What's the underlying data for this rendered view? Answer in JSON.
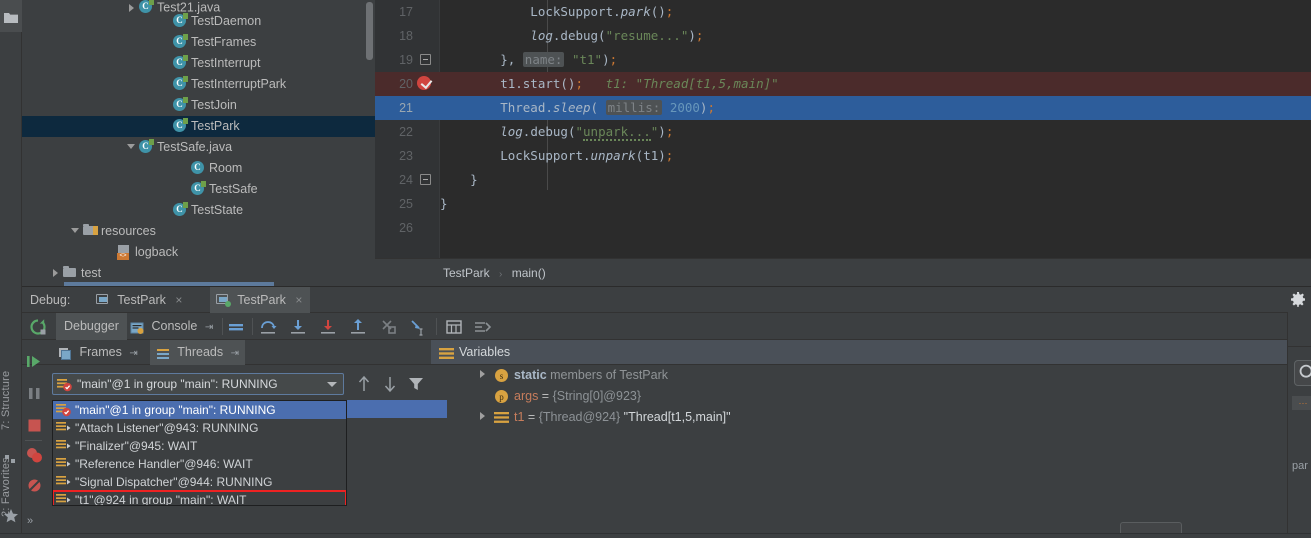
{
  "left_strip": {
    "folder_icon": "folder-icon",
    "tabs": [
      {
        "label": "7: Structure",
        "icon": "structure-icon"
      },
      {
        "label": "2: Favorites",
        "icon": "star-icon"
      }
    ]
  },
  "project_tree": {
    "items": [
      {
        "label": "Test21.java",
        "icon": "java-class-icon",
        "arrow": "collapsed",
        "indent": 118,
        "selected": false,
        "clipped": true
      },
      {
        "label": "TestDaemon",
        "icon": "java-class-icon",
        "arrow": "none",
        "indent": 152,
        "selected": false
      },
      {
        "label": "TestFrames",
        "icon": "java-class-icon",
        "arrow": "none",
        "indent": 152,
        "selected": false
      },
      {
        "label": "TestInterrupt",
        "icon": "java-class-icon",
        "arrow": "none",
        "indent": 152,
        "selected": false
      },
      {
        "label": "TestInterruptPark",
        "icon": "java-class-icon",
        "arrow": "none",
        "indent": 152,
        "selected": false
      },
      {
        "label": "TestJoin",
        "icon": "java-class-icon",
        "arrow": "none",
        "indent": 152,
        "selected": false
      },
      {
        "label": "TestPark",
        "icon": "java-class-icon",
        "arrow": "none",
        "indent": 152,
        "selected": true
      },
      {
        "label": "TestSafe.java",
        "icon": "java-class-icon",
        "arrow": "expanded",
        "indent": 118,
        "selected": false
      },
      {
        "label": "Room",
        "icon": "class-icon",
        "arrow": "none",
        "indent": 170,
        "selected": false
      },
      {
        "label": "TestSafe",
        "icon": "java-class-icon",
        "arrow": "none",
        "indent": 170,
        "selected": false
      },
      {
        "label": "TestState",
        "icon": "java-class-icon",
        "arrow": "none",
        "indent": 152,
        "selected": false
      },
      {
        "label": "resources",
        "icon": "resources-folder-icon",
        "arrow": "expanded",
        "indent": 62,
        "selected": false
      },
      {
        "label": "logback",
        "icon": "xml-file-icon",
        "arrow": "none",
        "indent": 96,
        "selected": false
      },
      {
        "label": "test",
        "icon": "folder-icon",
        "arrow": "collapsed",
        "indent": 42,
        "selected": false
      }
    ]
  },
  "editor": {
    "lines": [
      {
        "num": "17",
        "fold": false,
        "breakpoint": false,
        "current": false,
        "tokens": [
          {
            "t": "            LockSupport.",
            "c": "ident"
          },
          {
            "t": "park",
            "c": "meth"
          },
          {
            "t": "()",
            "c": "ident"
          },
          {
            "t": ";",
            "c": "semi"
          }
        ]
      },
      {
        "num": "18",
        "fold": false,
        "breakpoint": false,
        "current": false,
        "tokens": [
          {
            "t": "            ",
            "c": "ident"
          },
          {
            "t": "log",
            "c": "meth"
          },
          {
            "t": ".debug(",
            "c": "ident"
          },
          {
            "t": "\"resume...\"",
            "c": "str"
          },
          {
            "t": ")",
            "c": "ident"
          },
          {
            "t": ";",
            "c": "semi"
          }
        ]
      },
      {
        "num": "19",
        "fold": true,
        "breakpoint": false,
        "current": false,
        "tokens": [
          {
            "t": "        }, ",
            "c": "ident"
          },
          {
            "t": "name:",
            "c": "hint"
          },
          {
            "t": " ",
            "c": "ident"
          },
          {
            "t": "\"t1\"",
            "c": "str"
          },
          {
            "t": ")",
            "c": "ident"
          },
          {
            "t": ";",
            "c": "semi"
          }
        ]
      },
      {
        "num": "20",
        "fold": false,
        "breakpoint": true,
        "current": false,
        "tokens": [
          {
            "t": "        t1.start()",
            "c": "ident"
          },
          {
            "t": ";",
            "c": "semi"
          },
          {
            "t": "   t1: \"Thread[t1,5,main]\"",
            "c": "inline-val"
          }
        ]
      },
      {
        "num": "21",
        "fold": false,
        "breakpoint": false,
        "current": true,
        "tokens": [
          {
            "t": "        Thread.",
            "c": "ident"
          },
          {
            "t": "sleep",
            "c": "meth"
          },
          {
            "t": "( ",
            "c": "ident"
          },
          {
            "t": "millis:",
            "c": "hint"
          },
          {
            "t": " ",
            "c": "ident"
          },
          {
            "t": "2000",
            "c": "num2"
          },
          {
            "t": ")",
            "c": "ident"
          },
          {
            "t": ";",
            "c": "semi"
          }
        ]
      },
      {
        "num": "22",
        "fold": false,
        "breakpoint": false,
        "current": false,
        "tokens": [
          {
            "t": "        ",
            "c": "ident"
          },
          {
            "t": "log",
            "c": "meth"
          },
          {
            "t": ".debug(",
            "c": "ident"
          },
          {
            "t": "\"",
            "c": "str"
          },
          {
            "t": "unpark...",
            "c": "str warn"
          },
          {
            "t": "\"",
            "c": "str"
          },
          {
            "t": ")",
            "c": "ident"
          },
          {
            "t": ";",
            "c": "semi"
          }
        ]
      },
      {
        "num": "23",
        "fold": false,
        "breakpoint": false,
        "current": false,
        "tokens": [
          {
            "t": "        LockSupport.",
            "c": "ident"
          },
          {
            "t": "unpark",
            "c": "meth"
          },
          {
            "t": "(t1)",
            "c": "ident"
          },
          {
            "t": ";",
            "c": "semi"
          }
        ]
      },
      {
        "num": "24",
        "fold": true,
        "breakpoint": false,
        "current": false,
        "tokens": [
          {
            "t": "    }",
            "c": "ident"
          }
        ]
      },
      {
        "num": "25",
        "fold": false,
        "breakpoint": false,
        "current": false,
        "tokens": [
          {
            "t": "}",
            "c": "ident"
          }
        ]
      },
      {
        "num": "26",
        "fold": false,
        "breakpoint": false,
        "current": false,
        "tokens": []
      }
    ]
  },
  "breadcrumb": {
    "class": "TestPark",
    "separator": "›",
    "method": "main()"
  },
  "debug": {
    "title": "Debug:",
    "tabs": [
      {
        "label": "TestPark",
        "active": false,
        "running": false,
        "close": "×"
      },
      {
        "label": "TestPark",
        "active": true,
        "running": true,
        "close": "×"
      }
    ],
    "settings_icon": "gear-icon",
    "rerun_icon": "rerun-icon",
    "subtabs": [
      {
        "label": "Debugger",
        "active": true,
        "icon": null
      },
      {
        "label": "Console",
        "active": false,
        "icon": "console-icon",
        "pin": "⇥"
      }
    ],
    "toolbar_icons": [
      "show-execution-point-icon",
      "step-over-icon",
      "step-into-icon",
      "force-step-into-icon",
      "step-out-icon",
      "drop-frame-icon",
      "run-to-cursor-icon",
      "evaluate-expression-icon",
      "mute-breakpoints-icon"
    ],
    "action_icons": [
      "resume-program-icon",
      "pause-program-icon",
      "stop-icon",
      "view-breakpoints-icon",
      "mute-breakpoints-side-icon"
    ],
    "more_actions": "»",
    "frames_tab": {
      "label": "Frames",
      "icon": "frames-icon",
      "pin": "⇥",
      "active": false
    },
    "threads_tab": {
      "label": "Threads",
      "icon": "threads-icon",
      "pin": "⇥",
      "active": true
    },
    "thread_selector": {
      "value": "\"main\"@1 in group \"main\": RUNNING",
      "icon": "current-thread-icon",
      "up_icon": "arrow-up-icon",
      "down_icon": "arrow-down-icon",
      "filter_icon": "filter-icon"
    },
    "thread_list": [
      {
        "label": "\"main\"@1 in group \"main\": RUNNING",
        "icon": "current-thread-icon",
        "selected": true,
        "flagged": false
      },
      {
        "label": "\"Attach Listener\"@943: RUNNING",
        "icon": "thread-icon",
        "selected": false,
        "flagged": false
      },
      {
        "label": "\"Finalizer\"@945: WAIT",
        "icon": "thread-icon",
        "selected": false,
        "flagged": false
      },
      {
        "label": "\"Reference Handler\"@946: WAIT",
        "icon": "thread-icon",
        "selected": false,
        "flagged": false
      },
      {
        "label": "\"Signal Dispatcher\"@944: RUNNING",
        "icon": "thread-icon",
        "selected": false,
        "flagged": false
      },
      {
        "label": "\"t1\"@924 in group \"main\": WAIT",
        "icon": "thread-icon",
        "selected": false,
        "flagged": true
      }
    ]
  },
  "variables": {
    "header": "Variables",
    "header_icon": "variables-icon",
    "pin": "⇥",
    "side_buttons": [
      "add-watch-icon",
      "remove-watch-icon",
      "move-up-icon",
      "move-down-icon",
      "copy-value-icon",
      "watches-icon"
    ],
    "rows": [
      {
        "arrow": true,
        "icon": "static-icon",
        "segments": [
          {
            "t": "static",
            "c": "v-static"
          },
          {
            "t": " members of TestPark",
            "c": "v-dim"
          }
        ]
      },
      {
        "arrow": false,
        "icon": "param-icon",
        "segments": [
          {
            "t": "args",
            "c": "v-name"
          },
          {
            "t": " = ",
            "c": "v-eq"
          },
          {
            "t": "{String[0]@923}",
            "c": "v-ref"
          }
        ]
      },
      {
        "arrow": true,
        "icon": "object-icon",
        "segments": [
          {
            "t": "t1",
            "c": "v-name"
          },
          {
            "t": " = ",
            "c": "v-eq"
          },
          {
            "t": "{Thread@924} ",
            "c": "v-ref"
          },
          {
            "t": "\"Thread[t1,5,main]\"",
            "c": "v-str"
          }
        ]
      }
    ]
  },
  "right_sliver": {
    "button_icon": "search-icon",
    "dots": "···",
    "text": "par"
  },
  "colors": {
    "accent_blue": "#4b6eaf",
    "selection_blue": "#2d5d9b",
    "tree_selection": "#0d293e",
    "breakpoint_red": "#d0453f",
    "breakpoint_line": "#4b2b2b",
    "flag_red": "#ee2222",
    "running_green": "#59a869",
    "panel_bg": "#3c3f41",
    "editor_bg": "#2b2b2b"
  }
}
